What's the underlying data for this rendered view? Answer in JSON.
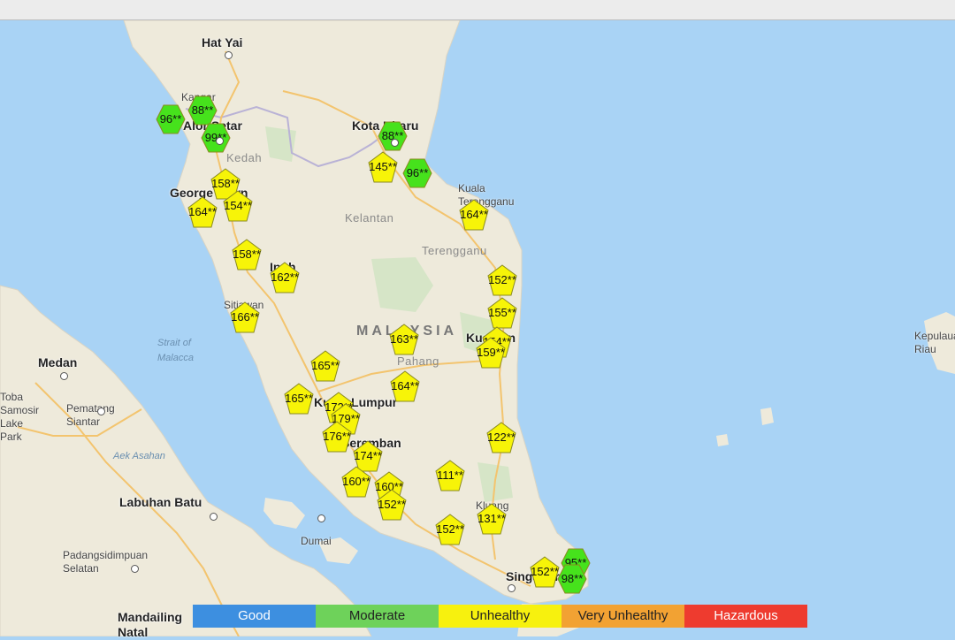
{
  "map": {
    "labels": [
      {
        "name": "city-hat-yai",
        "text": "Hat Yai",
        "cls": "city"
      },
      {
        "name": "town-kangar",
        "text": "Kangar",
        "cls": "town"
      },
      {
        "name": "city-alor-setar",
        "text": "Alor Setar",
        "cls": "city"
      },
      {
        "name": "region-kedah",
        "text": "Kedah",
        "cls": "region"
      },
      {
        "name": "city-kota-bharu",
        "text": "Kota Bharu",
        "cls": "city"
      },
      {
        "name": "city-george-town",
        "text": "George Town",
        "cls": "city"
      },
      {
        "name": "town-kuala-terengganu",
        "text": "Kuala\nTerengganu",
        "cls": "town"
      },
      {
        "name": "region-kelantan",
        "text": "Kelantan",
        "cls": "region"
      },
      {
        "name": "region-terengganu",
        "text": "Terengganu",
        "cls": "region"
      },
      {
        "name": "city-ipoh",
        "text": "Ipoh",
        "cls": "city"
      },
      {
        "name": "town-sitiawan",
        "text": "Sitiawan",
        "cls": "town"
      },
      {
        "name": "water-strait-of-malacca",
        "text": "Strait of\nMalacca",
        "cls": "water"
      },
      {
        "name": "country-malaysia",
        "text": "MALAYSIA",
        "cls": "country"
      },
      {
        "name": "city-kuantan",
        "text": "Kuantan",
        "cls": "city"
      },
      {
        "name": "region-pahang",
        "text": "Pahang",
        "cls": "region"
      },
      {
        "name": "city-medan",
        "text": "Medan",
        "cls": "city"
      },
      {
        "name": "city-kuala-lumpur",
        "text": "Kuala Lumpur",
        "cls": "city"
      },
      {
        "name": "town-pematang-siantar",
        "text": "Pematang\nSiantar",
        "cls": "town"
      },
      {
        "name": "city-seremban",
        "text": "Seremban",
        "cls": "city"
      },
      {
        "name": "water-aek-asahan",
        "text": "Aek Asahan",
        "cls": "water"
      },
      {
        "name": "city-labuhan-batu",
        "text": "Labuhan Batu",
        "cls": "city"
      },
      {
        "name": "town-kluang",
        "text": "Kluang",
        "cls": "town"
      },
      {
        "name": "town-dumai",
        "text": "Dumai",
        "cls": "town"
      },
      {
        "name": "town-padangsidimpuan",
        "text": "Padangsidimpuan\nSelatan",
        "cls": "town"
      },
      {
        "name": "city-singapore",
        "text": "Singapore",
        "cls": "city"
      },
      {
        "name": "city-mandailing-natal",
        "text": "Mandailing\nNatal",
        "cls": "city"
      },
      {
        "name": "town-kepulauan-riau",
        "text": "Kepulauan\nRiau",
        "cls": "town"
      },
      {
        "name": "town-toba",
        "text": "Toba\nSamosir\nLake\nPark",
        "cls": "town"
      }
    ],
    "markers": [
      {
        "value": "96**",
        "category": "moderate"
      },
      {
        "value": "88**",
        "category": "moderate"
      },
      {
        "value": "99**",
        "category": "moderate"
      },
      {
        "value": "88**",
        "category": "moderate"
      },
      {
        "value": "96**",
        "category": "moderate"
      },
      {
        "value": "145**",
        "category": "unhealthy"
      },
      {
        "value": "158**",
        "category": "unhealthy"
      },
      {
        "value": "164**",
        "category": "unhealthy"
      },
      {
        "value": "154**",
        "category": "unhealthy"
      },
      {
        "value": "164**",
        "category": "unhealthy"
      },
      {
        "value": "158**",
        "category": "unhealthy"
      },
      {
        "value": "162**",
        "category": "unhealthy"
      },
      {
        "value": "166**",
        "category": "unhealthy"
      },
      {
        "value": "152**",
        "category": "unhealthy"
      },
      {
        "value": "155**",
        "category": "unhealthy"
      },
      {
        "value": "163**",
        "category": "unhealthy"
      },
      {
        "value": "154**",
        "category": "unhealthy"
      },
      {
        "value": "159**",
        "category": "unhealthy"
      },
      {
        "value": "165**",
        "category": "unhealthy"
      },
      {
        "value": "164**",
        "category": "unhealthy"
      },
      {
        "value": "165**",
        "category": "unhealthy"
      },
      {
        "value": "172**",
        "category": "unhealthy"
      },
      {
        "value": "179**",
        "category": "unhealthy"
      },
      {
        "value": "176**",
        "category": "unhealthy"
      },
      {
        "value": "122**",
        "category": "unhealthy"
      },
      {
        "value": "174**",
        "category": "unhealthy"
      },
      {
        "value": "111**",
        "category": "unhealthy"
      },
      {
        "value": "160**",
        "category": "unhealthy"
      },
      {
        "value": "160**",
        "category": "unhealthy"
      },
      {
        "value": "152**",
        "category": "unhealthy"
      },
      {
        "value": "131**",
        "category": "unhealthy"
      },
      {
        "value": "152**",
        "category": "unhealthy"
      },
      {
        "value": "152**",
        "category": "unhealthy"
      },
      {
        "value": "95**",
        "category": "moderate"
      },
      {
        "value": "98**",
        "category": "moderate"
      }
    ]
  },
  "legend": [
    {
      "label": "Good",
      "color": "#3d8fe0",
      "text_color": "light"
    },
    {
      "label": "Moderate",
      "color": "#6ed25a",
      "text_color": "dark"
    },
    {
      "label": "Unhealthy",
      "color": "#f7f10e",
      "text_color": "dark"
    },
    {
      "label": "Very Unhealthy",
      "color": "#f2a233",
      "text_color": "dark"
    },
    {
      "label": "Hazardous",
      "color": "#ee3b2f",
      "text_color": "light"
    }
  ],
  "colors": {
    "sea": "#a9d3f5",
    "land": "#eeeadb",
    "forest": "#cfe3c2",
    "road": "#f3c46e",
    "moderate": "#46e21c",
    "unhealthy": "#f7f408"
  }
}
